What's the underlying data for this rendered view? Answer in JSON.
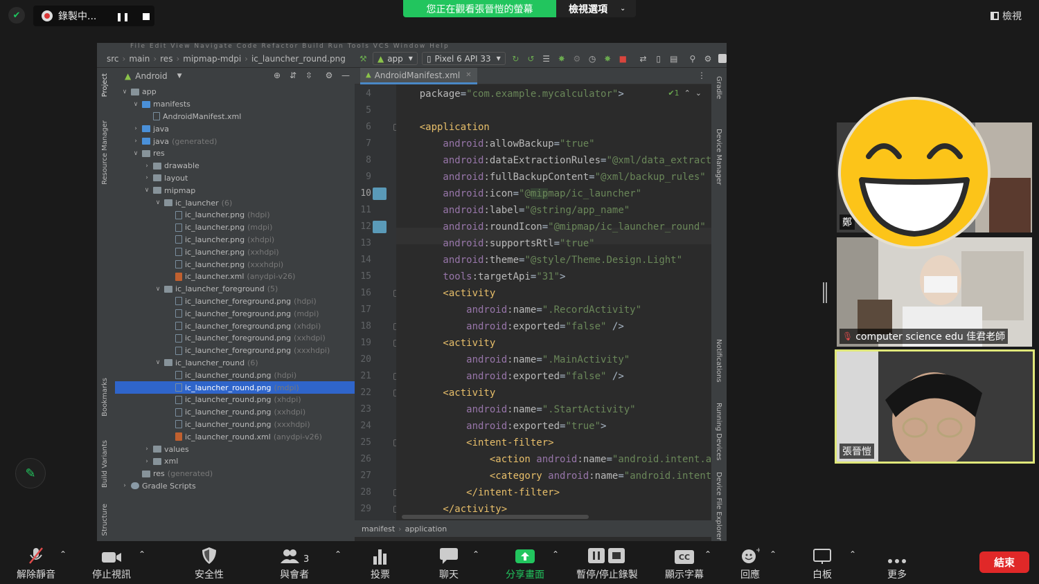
{
  "topbar": {
    "recording_label": "錄製中...",
    "viewing_banner": "您正在觀看張晉愷的螢幕",
    "view_options": "檢視選項",
    "view_button": "檢視"
  },
  "ide": {
    "menu_text": "File  Edit  View  Navigate  Code  Refactor  Build  Run  Tools  VCS  Window  Help",
    "breadcrumbs": [
      "src",
      "main",
      "res",
      "mipmap-mdpi",
      "ic_launcher_round.png"
    ],
    "run_config": "app",
    "device": "Pixel 6 API 33",
    "project_view": "Android",
    "left_tool_labels": [
      "Project",
      "Resource Manager",
      "Bookmarks",
      "Build Variants",
      "Structure"
    ],
    "right_tool_labels": [
      "Gradle",
      "Device Manager",
      "Notifications",
      "Running Devices",
      "Device File Explorer"
    ],
    "tree": [
      {
        "depth": 0,
        "arrow": "v",
        "icon": "folder",
        "name": "app",
        "dim": ""
      },
      {
        "depth": 1,
        "arrow": "v",
        "icon": "blue",
        "name": "manifests",
        "dim": ""
      },
      {
        "depth": 2,
        "arrow": "",
        "icon": "file",
        "name": "AndroidManifest.xml",
        "dim": ""
      },
      {
        "depth": 1,
        "arrow": ">",
        "icon": "blue",
        "name": "java",
        "dim": ""
      },
      {
        "depth": 1,
        "arrow": ">",
        "icon": "blue",
        "name": "java",
        "dim": "(generated)"
      },
      {
        "depth": 1,
        "arrow": "v",
        "icon": "folder",
        "name": "res",
        "dim": ""
      },
      {
        "depth": 2,
        "arrow": ">",
        "icon": "folder",
        "name": "drawable",
        "dim": ""
      },
      {
        "depth": 2,
        "arrow": ">",
        "icon": "folder",
        "name": "layout",
        "dim": ""
      },
      {
        "depth": 2,
        "arrow": "v",
        "icon": "folder",
        "name": "mipmap",
        "dim": ""
      },
      {
        "depth": 3,
        "arrow": "v",
        "icon": "folder",
        "name": "ic_launcher",
        "dim": "(6)"
      },
      {
        "depth": 4,
        "arrow": "",
        "icon": "file",
        "name": "ic_launcher.png",
        "dim": "(hdpi)"
      },
      {
        "depth": 4,
        "arrow": "",
        "icon": "file",
        "name": "ic_launcher.png",
        "dim": "(mdpi)"
      },
      {
        "depth": 4,
        "arrow": "",
        "icon": "file",
        "name": "ic_launcher.png",
        "dim": "(xhdpi)"
      },
      {
        "depth": 4,
        "arrow": "",
        "icon": "file",
        "name": "ic_launcher.png",
        "dim": "(xxhdpi)"
      },
      {
        "depth": 4,
        "arrow": "",
        "icon": "file",
        "name": "ic_launcher.png",
        "dim": "(xxxhdpi)"
      },
      {
        "depth": 4,
        "arrow": "",
        "icon": "xml",
        "name": "ic_launcher.xml",
        "dim": "(anydpi-v26)"
      },
      {
        "depth": 3,
        "arrow": "v",
        "icon": "folder",
        "name": "ic_launcher_foreground",
        "dim": "(5)"
      },
      {
        "depth": 4,
        "arrow": "",
        "icon": "file",
        "name": "ic_launcher_foreground.png",
        "dim": "(hdpi)"
      },
      {
        "depth": 4,
        "arrow": "",
        "icon": "file",
        "name": "ic_launcher_foreground.png",
        "dim": "(mdpi)"
      },
      {
        "depth": 4,
        "arrow": "",
        "icon": "file",
        "name": "ic_launcher_foreground.png",
        "dim": "(xhdpi)"
      },
      {
        "depth": 4,
        "arrow": "",
        "icon": "file",
        "name": "ic_launcher_foreground.png",
        "dim": "(xxhdpi)"
      },
      {
        "depth": 4,
        "arrow": "",
        "icon": "file",
        "name": "ic_launcher_foreground.png",
        "dim": "(xxxhdpi)"
      },
      {
        "depth": 3,
        "arrow": "v",
        "icon": "folder",
        "name": "ic_launcher_round",
        "dim": "(6)"
      },
      {
        "depth": 4,
        "arrow": "",
        "icon": "file",
        "name": "ic_launcher_round.png",
        "dim": "(hdpi)"
      },
      {
        "depth": 4,
        "arrow": "",
        "icon": "file",
        "name": "ic_launcher_round.png",
        "dim": "(mdpi)",
        "selected": true
      },
      {
        "depth": 4,
        "arrow": "",
        "icon": "file",
        "name": "ic_launcher_round.png",
        "dim": "(xhdpi)"
      },
      {
        "depth": 4,
        "arrow": "",
        "icon": "file",
        "name": "ic_launcher_round.png",
        "dim": "(xxhdpi)"
      },
      {
        "depth": 4,
        "arrow": "",
        "icon": "file",
        "name": "ic_launcher_round.png",
        "dim": "(xxxhdpi)"
      },
      {
        "depth": 4,
        "arrow": "",
        "icon": "xml",
        "name": "ic_launcher_round.xml",
        "dim": "(anydpi-v26)"
      },
      {
        "depth": 2,
        "arrow": ">",
        "icon": "folder",
        "name": "values",
        "dim": ""
      },
      {
        "depth": 2,
        "arrow": ">",
        "icon": "folder",
        "name": "xml",
        "dim": ""
      },
      {
        "depth": 1,
        "arrow": "",
        "icon": "folder",
        "name": "res",
        "dim": "(generated)"
      },
      {
        "depth": 0,
        "arrow": ">",
        "icon": "gradle",
        "name": "Gradle Scripts",
        "dim": ""
      }
    ],
    "editor_tab": "AndroidManifest.xml",
    "inspection": "✔1",
    "line_numbers": [
      "4",
      "5",
      "6",
      "7",
      "8",
      "9",
      "10",
      "11",
      "12",
      "13",
      "14",
      "15",
      "16",
      "17",
      "18",
      "19",
      "20",
      "21",
      "22",
      "23",
      "24",
      "25",
      "26",
      "27",
      "28",
      "29"
    ],
    "code_lines": [
      [
        [
          "attr",
          "    package"
        ],
        [
          "plain",
          "="
        ],
        [
          "str",
          "\"com.example.mycalculator\""
        ],
        [
          "plain",
          ">"
        ]
      ],
      [],
      [
        [
          "tag",
          "    <application"
        ]
      ],
      [
        [
          "ns",
          "        android"
        ],
        [
          "attr",
          ":allowBackup"
        ],
        [
          "plain",
          "="
        ],
        [
          "str",
          "\"true\""
        ]
      ],
      [
        [
          "ns",
          "        android"
        ],
        [
          "attr",
          ":dataExtractionRules"
        ],
        [
          "plain",
          "="
        ],
        [
          "str",
          "\"@xml/data_extraction_rules\""
        ]
      ],
      [
        [
          "ns",
          "        android"
        ],
        [
          "attr",
          ":fullBackupContent"
        ],
        [
          "plain",
          "="
        ],
        [
          "str",
          "\"@xml/backup_rules\""
        ]
      ],
      [
        [
          "ns",
          "        android"
        ],
        [
          "attr",
          ":icon"
        ],
        [
          "plain",
          "="
        ],
        [
          "str",
          "\"@"
        ],
        [
          "hl",
          "mip"
        ],
        [
          "str",
          "map/ic_launcher\""
        ]
      ],
      [
        [
          "ns",
          "        android"
        ],
        [
          "attr",
          ":label"
        ],
        [
          "plain",
          "="
        ],
        [
          "str",
          "\"@string/app_name\""
        ]
      ],
      [
        [
          "ns",
          "        android"
        ],
        [
          "attr",
          ":roundIcon"
        ],
        [
          "plain",
          "="
        ],
        [
          "str",
          "\"@mipmap/ic_launcher_round\""
        ]
      ],
      [
        [
          "ns",
          "        android"
        ],
        [
          "attr",
          ":supportsRtl"
        ],
        [
          "plain",
          "="
        ],
        [
          "str",
          "\"true\""
        ]
      ],
      [
        [
          "ns",
          "        android"
        ],
        [
          "attr",
          ":theme"
        ],
        [
          "plain",
          "="
        ],
        [
          "str",
          "\"@style/Theme.Design.Light\""
        ]
      ],
      [
        [
          "ns",
          "        tools"
        ],
        [
          "attr",
          ":targetApi"
        ],
        [
          "plain",
          "="
        ],
        [
          "str",
          "\"31\""
        ],
        [
          "plain",
          ">"
        ]
      ],
      [
        [
          "tag",
          "        <activity"
        ]
      ],
      [
        [
          "ns",
          "            android"
        ],
        [
          "attr",
          ":name"
        ],
        [
          "plain",
          "="
        ],
        [
          "str",
          "\".RecordActivity\""
        ]
      ],
      [
        [
          "ns",
          "            android"
        ],
        [
          "attr",
          ":exported"
        ],
        [
          "plain",
          "="
        ],
        [
          "str",
          "\"false\""
        ],
        [
          "plain",
          " />"
        ]
      ],
      [
        [
          "tag",
          "        <activity"
        ]
      ],
      [
        [
          "ns",
          "            android"
        ],
        [
          "attr",
          ":name"
        ],
        [
          "plain",
          "="
        ],
        [
          "str",
          "\".MainActivity\""
        ]
      ],
      [
        [
          "ns",
          "            android"
        ],
        [
          "attr",
          ":exported"
        ],
        [
          "plain",
          "="
        ],
        [
          "str",
          "\"false\""
        ],
        [
          "plain",
          " />"
        ]
      ],
      [
        [
          "tag",
          "        <activity"
        ]
      ],
      [
        [
          "ns",
          "            android"
        ],
        [
          "attr",
          ":name"
        ],
        [
          "plain",
          "="
        ],
        [
          "str",
          "\".StartActivity\""
        ]
      ],
      [
        [
          "ns",
          "            android"
        ],
        [
          "attr",
          ":exported"
        ],
        [
          "plain",
          "="
        ],
        [
          "str",
          "\"true\""
        ],
        [
          "plain",
          ">"
        ]
      ],
      [
        [
          "tag",
          "            <intent-filter>"
        ]
      ],
      [
        [
          "tag",
          "                <action "
        ],
        [
          "ns",
          "android"
        ],
        [
          "attr",
          ":name"
        ],
        [
          "plain",
          "="
        ],
        [
          "str",
          "\"android.intent.action.MAIN\""
        ]
      ],
      [
        [
          "tag",
          "                <category "
        ],
        [
          "ns",
          "android"
        ],
        [
          "attr",
          ":name"
        ],
        [
          "plain",
          "="
        ],
        [
          "str",
          "\"android.intent.category.LAUNCHER\""
        ]
      ],
      [
        [
          "tag",
          "            </intent-filter>"
        ]
      ],
      [
        [
          "tag",
          "        </activity>"
        ]
      ]
    ],
    "status_crumbs": [
      "manifest",
      "application"
    ]
  },
  "participants": [
    {
      "name": "鄭",
      "muted": false
    },
    {
      "name": "computer science edu 佳君老師",
      "muted": true
    },
    {
      "name": "張晉愷",
      "muted": false
    }
  ],
  "toolbar": {
    "unmute": "解除靜音",
    "stop_video": "停止視訊",
    "security": "安全性",
    "participants": "與會者",
    "participants_count": "3",
    "polls": "投票",
    "chat": "聊天",
    "share_screen": "分享畫面",
    "pause_stop_record": "暫停/停止錄製",
    "captions": "顯示字幕",
    "reactions": "回應",
    "whiteboard": "白板",
    "more": "更多",
    "end": "結束"
  },
  "colors": {
    "zoom_green": "#22c55e",
    "end_red": "#e02828",
    "ide_bg": "#2b2b2b",
    "selection": "#2f65ca"
  }
}
